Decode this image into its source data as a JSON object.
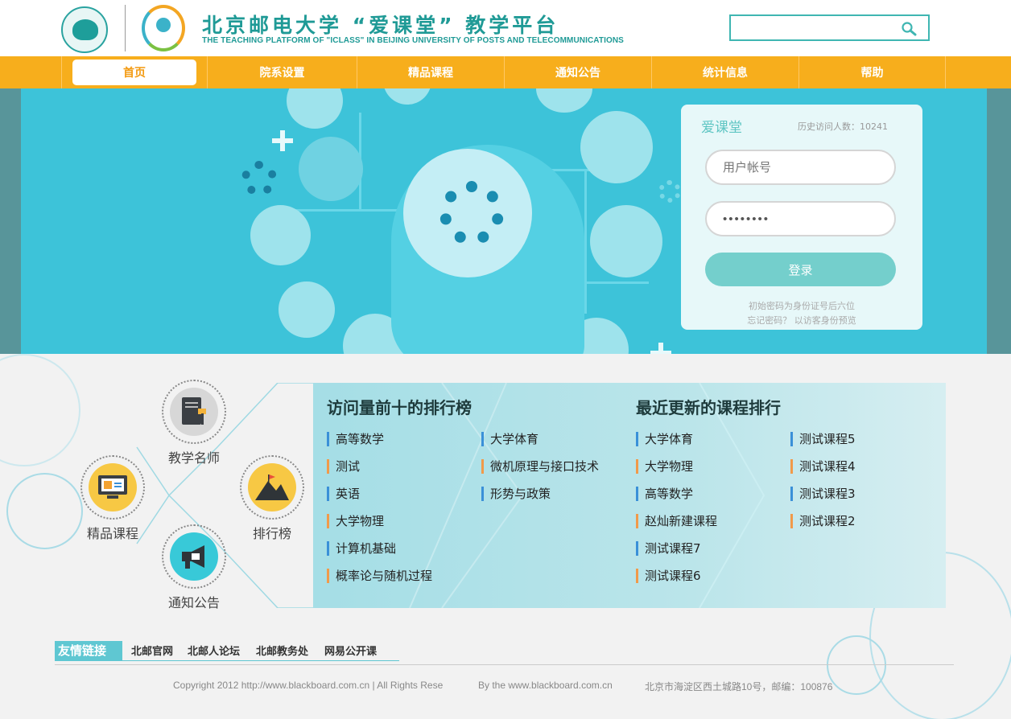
{
  "header": {
    "title": "北京邮电大学 “爱课堂” 教学平台",
    "subtitle": "THE TEACHING PLATFORM OF \"ICLASS\" IN BEIJING UNIVERSITY OF POSTS AND TELECOMMUNICATIONS",
    "search_placeholder": "",
    "search_icon": "search-icon"
  },
  "nav": {
    "items": [
      {
        "label": "首页",
        "active": true
      },
      {
        "label": "院系设置"
      },
      {
        "label": "精品课程"
      },
      {
        "label": "通知公告"
      },
      {
        "label": "统计信息"
      },
      {
        "label": "帮助"
      }
    ]
  },
  "login": {
    "title": "爱课堂",
    "visits": "历史访问人数：10241",
    "username_placeholder": "用户帐号",
    "password_value": "••••••••",
    "login_button": "登录",
    "hint1": "初始密码为身份证号后六位",
    "hint2": "忘记密码？  以访客身份预览"
  },
  "features": [
    {
      "label": "教学名师",
      "icon": "teacher-book-icon"
    },
    {
      "label": "精品课程",
      "icon": "computer-icon"
    },
    {
      "label": "排行榜",
      "icon": "mountain-flag-icon"
    },
    {
      "label": "通知公告",
      "icon": "megaphone-icon"
    }
  ],
  "ranking": {
    "top_visited_title": "访问量前十的排行榜",
    "recent_title": "最近更新的课程排行",
    "top_visited_col1": [
      "高等数学",
      "测试",
      "英语",
      "大学物理",
      "计算机基础",
      "概率论与随机过程"
    ],
    "top_visited_col2": [
      "大学体育",
      "微机原理与接口技术",
      "形势与政策"
    ],
    "recent_col1": [
      "大学体育",
      "大学物理",
      "高等数学",
      "赵灿新建课程",
      "测试课程7",
      "测试课程6"
    ],
    "recent_col2": [
      "测试课程5",
      "测试课程4",
      "测试课程3",
      "测试课程2"
    ]
  },
  "friend_links": {
    "label": "友情链接",
    "links": [
      "北邮官网",
      "北邮人论坛",
      "北邮教务处",
      "网易公开课"
    ]
  },
  "footer": {
    "copyright": "Copyright 2012 http://www.blackboard.com.cn | All Rights Rese",
    "by": "By the www.blackboard.com.cn",
    "address": "北京市海淀区西土城路10号，邮编：100876"
  },
  "colors": {
    "brand_teal": "#1f9a96",
    "nav_orange": "#f7ae1c",
    "banner_blue": "#3dc3d9",
    "login_button": "#74cfcc"
  }
}
